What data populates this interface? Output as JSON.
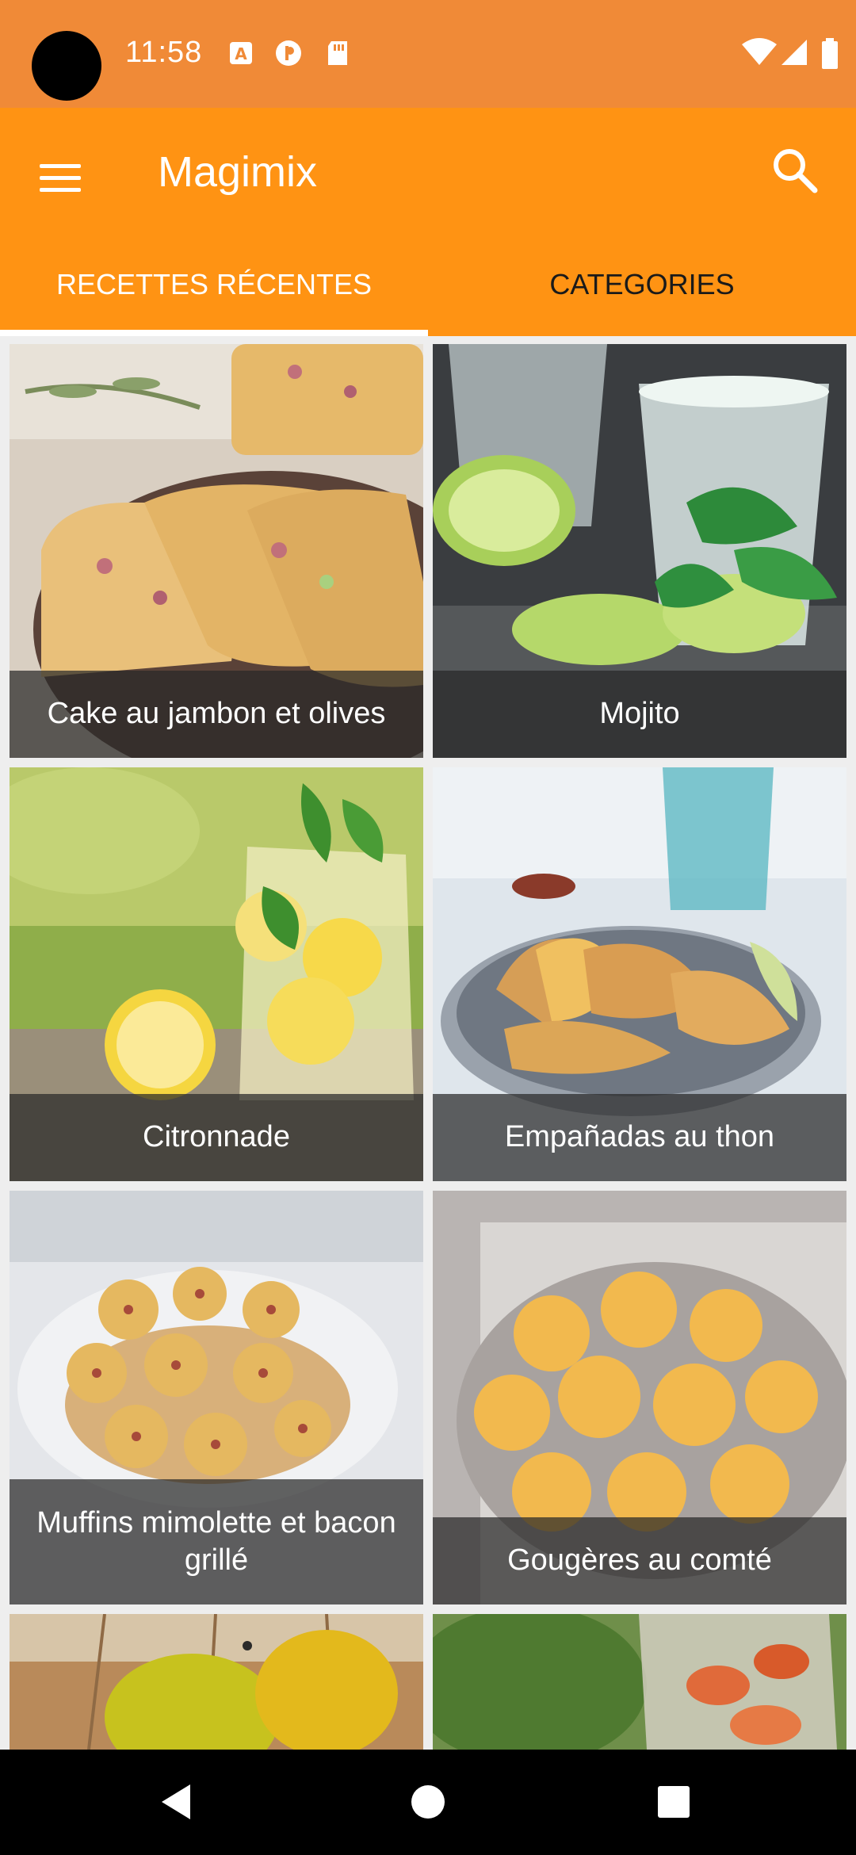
{
  "status_bar": {
    "time": "11:58",
    "left_icons": [
      "a-box-icon",
      "circle-p-icon",
      "sd-card-icon"
    ],
    "right_icons": [
      "wifi-icon",
      "cell-signal-icon",
      "battery-icon"
    ]
  },
  "app_bar": {
    "title": "Magimix",
    "menu_icon": "hamburger-menu-icon",
    "search_icon": "search-icon"
  },
  "tabs": [
    {
      "label": "RECETTES RÉCENTES",
      "active": true
    },
    {
      "label": "CATEGORIES",
      "active": false
    }
  ],
  "colors": {
    "status_bar": "#F08A37",
    "app_bar": "#FF9313",
    "caption_bg": "rgba(40,40,40,0.72)"
  },
  "recipes": [
    {
      "name": "Cake au jambon et olives"
    },
    {
      "name": "Mojito"
    },
    {
      "name": "Citronnade"
    },
    {
      "name": "Empañadas au thon"
    },
    {
      "name": "Muffins mimolette et bacon grillé"
    },
    {
      "name": "Gougères au comté"
    },
    {
      "name": ""
    },
    {
      "name": ""
    }
  ],
  "nav_bar": {
    "icons": [
      "back-triangle-icon",
      "home-circle-icon",
      "recents-square-icon"
    ]
  }
}
